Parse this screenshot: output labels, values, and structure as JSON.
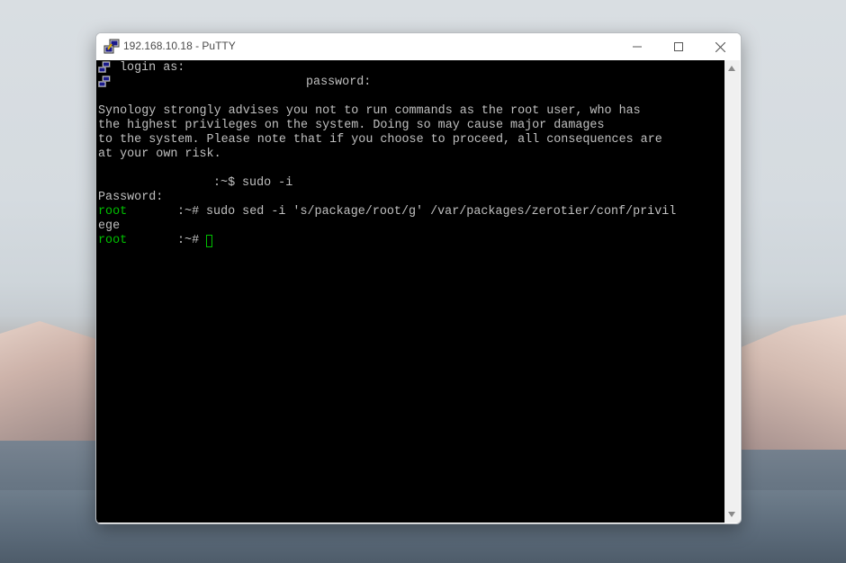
{
  "window": {
    "title": "192.168.10.18 - PuTTY"
  },
  "terminal": {
    "line1_prompt": "login as:",
    "line2_prompt": "password:",
    "warning_1": "Synology strongly advises you not to run commands as the root user, who has",
    "warning_2": "the highest privileges on the system. Doing so may cause major damages",
    "warning_3": "to the system. Please note that if you choose to proceed, all consequences are",
    "warning_4": "at your own risk.",
    "cmd_sudo_prompt": ":~$",
    "cmd_sudo": "sudo -i",
    "password_label": "Password:",
    "root_user": "root",
    "root_prompt": ":~#",
    "cmd_sed": "sudo sed -i 's/package/root/g' /var/packages/zerotier/conf/privil",
    "cmd_sed_wrap": "ege",
    "root_user_2": "root",
    "root_prompt_2": ":~#"
  },
  "icons": {
    "app": "putty-icon",
    "minimize": "minimize-icon",
    "maximize": "maximize-icon",
    "close": "close-icon",
    "scroll_up": "scroll-up-arrow-icon",
    "scroll_down": "scroll-down-arrow-icon"
  },
  "colors": {
    "terminal_bg": "#000000",
    "terminal_text": "#c0c0c0",
    "prompt_green": "#00c000"
  }
}
